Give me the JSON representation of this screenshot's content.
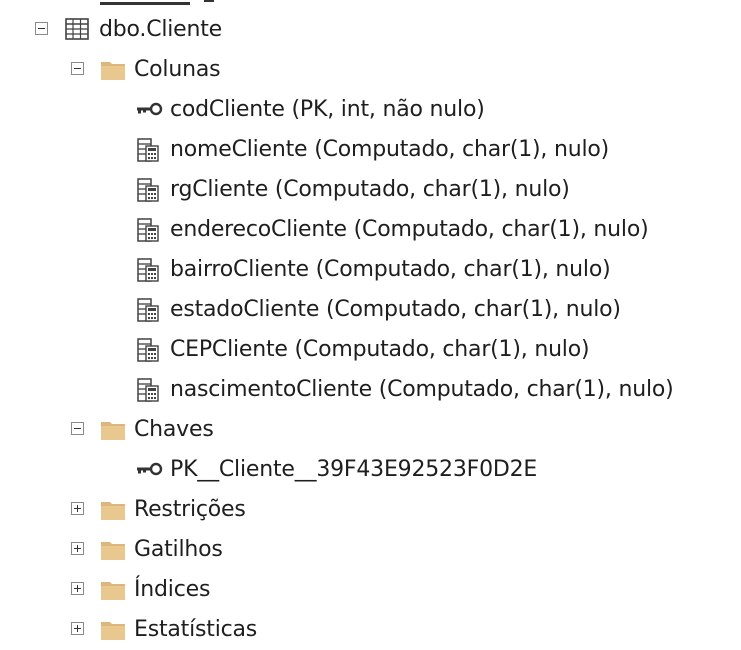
{
  "tree": {
    "table": {
      "label": "dbo.Cliente",
      "expanded": true,
      "icon": "table-icon"
    },
    "folders": {
      "colunas": {
        "label": "Colunas",
        "expanded": true
      },
      "chaves": {
        "label": "Chaves",
        "expanded": true
      },
      "restricoes": {
        "label": "Restrições",
        "expanded": false
      },
      "gatilhos": {
        "label": "Gatilhos",
        "expanded": false
      },
      "indices": {
        "label": "Índices",
        "expanded": false
      },
      "estatisticas": {
        "label": "Estatísticas",
        "expanded": false
      }
    },
    "columns": [
      {
        "label": "codCliente (PK, int, não nulo)",
        "icon": "key-icon"
      },
      {
        "label": "nomeCliente (Computado, char(1), nulo)",
        "icon": "computed-column-icon"
      },
      {
        "label": "rgCliente (Computado, char(1), nulo)",
        "icon": "computed-column-icon"
      },
      {
        "label": "enderecoCliente (Computado, char(1), nulo)",
        "icon": "computed-column-icon"
      },
      {
        "label": "bairroCliente (Computado, char(1), nulo)",
        "icon": "computed-column-icon"
      },
      {
        "label": "estadoCliente (Computado, char(1), nulo)",
        "icon": "computed-column-icon"
      },
      {
        "label": "CEPCliente (Computado, char(1), nulo)",
        "icon": "computed-column-icon"
      },
      {
        "label": "nascimentoCliente (Computado, char(1), nulo)",
        "icon": "computed-column-icon"
      }
    ],
    "keys": [
      {
        "label": "PK__Cliente__39F43E92523F0D2E",
        "icon": "key-icon"
      }
    ]
  },
  "colors": {
    "folder": "#dcb67a",
    "folder_dark": "#c9a15c",
    "icon_stroke": "#424242"
  }
}
